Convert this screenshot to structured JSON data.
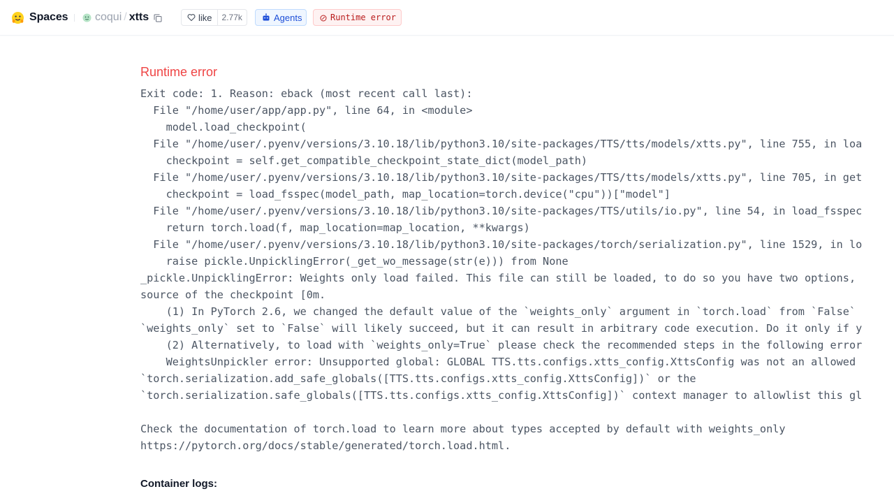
{
  "header": {
    "brand_label": "Spaces",
    "brand_icon": "hugging-face-logo",
    "org_name": "coqui",
    "repo_separator": "/",
    "repo_name": "xtts",
    "like_label": "like",
    "like_count": "2.77k",
    "agents_label": "Agents",
    "status_label": "Runtime error"
  },
  "colors": {
    "error": "#ef4444",
    "agents_accent": "#1d4ed8",
    "status_accent": "#b91c1c"
  },
  "main": {
    "error_title": "Runtime error",
    "traceback_lines": [
      "Exit code: 1. Reason: eback (most recent call last):",
      "  File \"/home/user/app/app.py\", line 64, in <module>",
      "    model.load_checkpoint(",
      "  File \"/home/user/.pyenv/versions/3.10.18/lib/python3.10/site-packages/TTS/tts/models/xtts.py\", line 755, in loa",
      "    checkpoint = self.get_compatible_checkpoint_state_dict(model_path)",
      "  File \"/home/user/.pyenv/versions/3.10.18/lib/python3.10/site-packages/TTS/tts/models/xtts.py\", line 705, in get",
      "    checkpoint = load_fsspec(model_path, map_location=torch.device(\"cpu\"))[\"model\"]",
      "  File \"/home/user/.pyenv/versions/3.10.18/lib/python3.10/site-packages/TTS/utils/io.py\", line 54, in load_fsspec",
      "    return torch.load(f, map_location=map_location, **kwargs)",
      "  File \"/home/user/.pyenv/versions/3.10.18/lib/python3.10/site-packages/torch/serialization.py\", line 1529, in lo",
      "    raise pickle.UnpicklingError(_get_wo_message(str(e))) from None",
      "_pickle.UnpicklingError: Weights only load failed. This file can still be loaded, to do so you have two options,",
      "source of the checkpoint [0m.",
      "    (1) In PyTorch 2.6, we changed the default value of the `weights_only` argument in `torch.load` from `False`",
      "`weights_only` set to `False` will likely succeed, but it can result in arbitrary code execution. Do it only if y",
      "    (2) Alternatively, to load with `weights_only=True` please check the recommended steps in the following error",
      "    WeightsUnpickler error: Unsupported global: GLOBAL TTS.tts.configs.xtts_config.XttsConfig was not an allowed",
      "`torch.serialization.add_safe_globals([TTS.tts.configs.xtts_config.XttsConfig])` or the",
      "`torch.serialization.safe_globals([TTS.tts.configs.xtts_config.XttsConfig])` context manager to allowlist this gl",
      "",
      "Check the documentation of torch.load to learn more about types accepted by default with weights_only",
      "https://pytorch.org/docs/stable/generated/torch.load.html."
    ],
    "logs_heading": "Container logs:"
  }
}
